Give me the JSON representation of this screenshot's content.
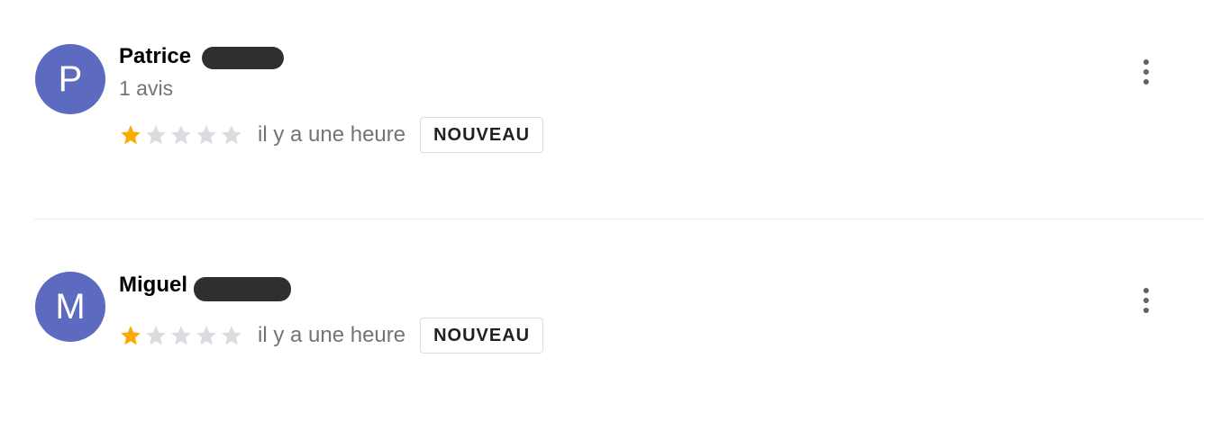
{
  "reviews": [
    {
      "initial": "P",
      "name": "Patrice",
      "review_count": "1 avis",
      "rating": 1,
      "max_rating": 5,
      "time": "il y a une heure",
      "badge": "NOUVEAU"
    },
    {
      "initial": "M",
      "name": "Miguel",
      "review_count": "",
      "rating": 1,
      "max_rating": 5,
      "time": "il y a une heure",
      "badge": "NOUVEAU"
    }
  ],
  "colors": {
    "avatar": "#5c6bc0",
    "star_filled": "#f9ab00",
    "star_empty": "#dadce0",
    "muted_text": "#70757a"
  },
  "icons": {
    "menu": "more-vert-icon",
    "star": "star-icon"
  }
}
